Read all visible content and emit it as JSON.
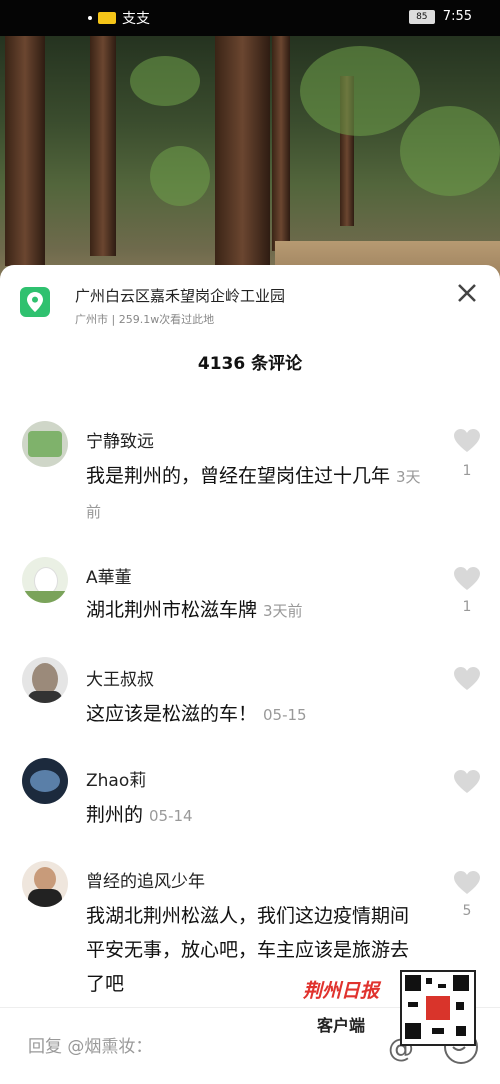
{
  "status_bar": {
    "left_text": "支支",
    "battery": "85",
    "time": "7:55"
  },
  "location": {
    "title": "广州白云区嘉禾望岗企岭工业园",
    "subtitle": "广州市 | 259.1w次看过此地"
  },
  "comments_count": "4136 条评论",
  "comments": [
    {
      "name": "宁静致远",
      "text": "我是荆州的，曾经在望岗住过十几年",
      "time": "3天前",
      "likes": "1"
    },
    {
      "name": "A華董",
      "text": "湖北荆州市松滋车牌",
      "time": "3天前",
      "likes": "1"
    },
    {
      "name": "大王叔叔",
      "text": "这应该是松滋的车！",
      "time": "05-15",
      "likes": ""
    },
    {
      "name": "Zhao莉",
      "text": "荆州的",
      "time": "05-14",
      "likes": ""
    },
    {
      "name": "曾经的追风少年",
      "text": "我湖北荆州松滋人，我们这边疫情期间平安无事，放心吧，车主应该是旅游去了吧",
      "time": "",
      "likes": "5"
    }
  ],
  "reply": {
    "placeholder": "回复 @烟熏妆："
  },
  "watermark": {
    "title": "荆州日报",
    "subtitle": "客户端"
  }
}
